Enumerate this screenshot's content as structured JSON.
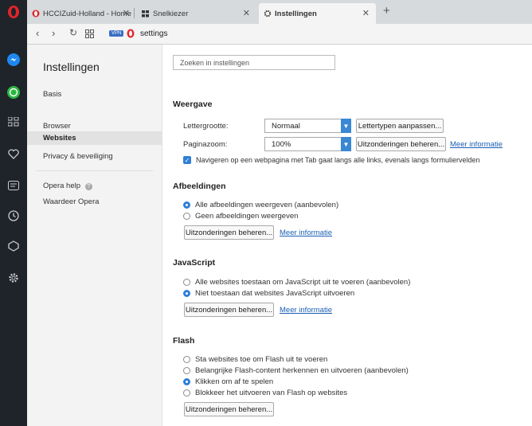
{
  "tabs": [
    {
      "title": "HCCIZuid-Holland - Home"
    },
    {
      "title": "Snelkiezer"
    },
    {
      "title": "Instellingen"
    }
  ],
  "address": {
    "vpn_badge": "VPN",
    "url": "settings"
  },
  "sidebar": {
    "title": "Instellingen",
    "items": [
      {
        "label": "Basis"
      },
      {
        "label": "Browser"
      },
      {
        "label": "Websites"
      },
      {
        "label": "Privacy & beveiliging"
      },
      {
        "label": "Opera help"
      },
      {
        "label": "Waardeer Opera"
      }
    ]
  },
  "search": {
    "placeholder": "Zoeken in instellingen"
  },
  "weergave": {
    "title": "Weergave",
    "font_label": "Lettergrootte:",
    "font_value": "Normaal",
    "font_button": "Lettertypen aanpassen...",
    "zoom_label": "Paginazoom:",
    "zoom_value": "100%",
    "zoom_button": "Uitzonderingen beheren...",
    "zoom_link": "Meer informatie",
    "tab_nav": "Navigeren op een webpagina met Tab gaat langs alle links, evenals langs formuliervelden"
  },
  "afbeeldingen": {
    "title": "Afbeeldingen",
    "options": [
      "Alle afbeeldingen weergeven (aanbevolen)",
      "Geen afbeeldingen weergeven"
    ],
    "button": "Uitzonderingen beheren...",
    "link": "Meer informatie"
  },
  "javascript": {
    "title": "JavaScript",
    "options": [
      "Alle websites toestaan om JavaScript uit te voeren (aanbevolen)",
      "Niet toestaan dat websites JavaScript uitvoeren"
    ],
    "button": "Uitzonderingen beheren...",
    "link": "Meer informatie"
  },
  "flash": {
    "title": "Flash",
    "options": [
      "Sta websites toe om Flash uit te voeren",
      "Belangrijke Flash-content herkennen en uitvoeren (aanbevolen)",
      "Klikken om af te spelen",
      "Blokkeer het uitvoeren van Flash op websites"
    ],
    "button": "Uitzonderingen beheren..."
  },
  "colors": {
    "accent": "#2f7fd8",
    "opera_red": "#e0262a",
    "rail": "#1f232a"
  }
}
